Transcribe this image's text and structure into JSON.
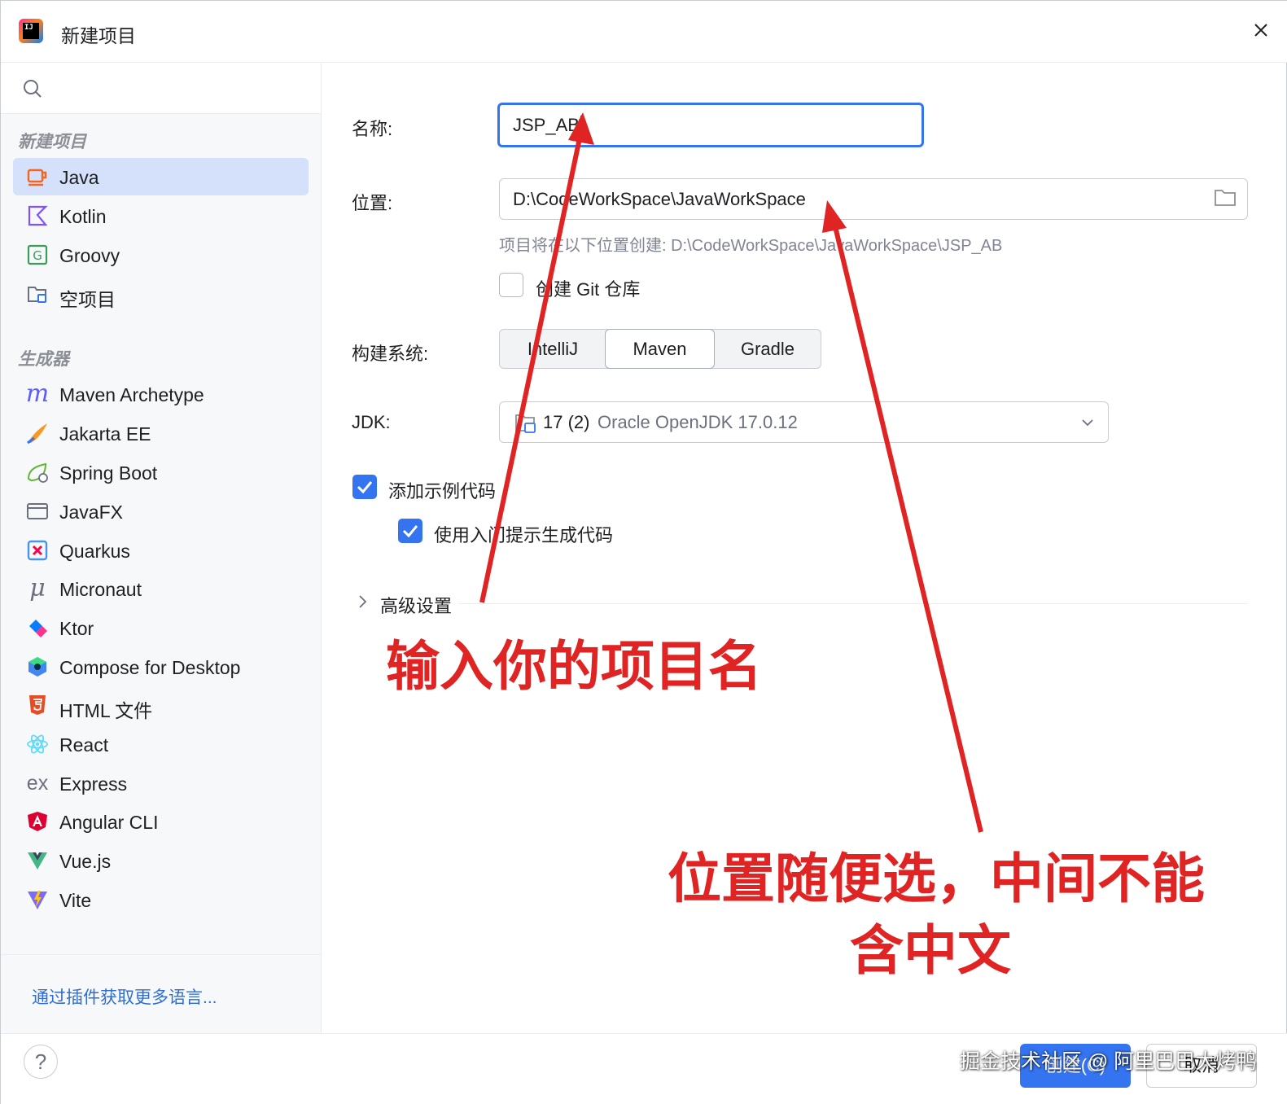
{
  "window": {
    "title": "新建项目",
    "close_icon": "close-icon",
    "app_icon": "intellij-idea-icon",
    "app_icon_text": "IJ"
  },
  "sidebar": {
    "search_icon": "search-icon",
    "new_project_header": "新建项目",
    "project_items": [
      {
        "label": "Java",
        "icon": "java-icon",
        "selected": true
      },
      {
        "label": "Kotlin",
        "icon": "kotlin-icon"
      },
      {
        "label": "Groovy",
        "icon": "groovy-icon"
      },
      {
        "label": "空项目",
        "icon": "empty-project-icon"
      }
    ],
    "generators_header": "生成器",
    "generator_items": [
      {
        "label": "Maven Archetype",
        "icon": "maven-icon"
      },
      {
        "label": "Jakarta EE",
        "icon": "jakarta-ee-icon"
      },
      {
        "label": "Spring Boot",
        "icon": "spring-boot-icon"
      },
      {
        "label": "JavaFX",
        "icon": "javafx-icon"
      },
      {
        "label": "Quarkus",
        "icon": "quarkus-icon"
      },
      {
        "label": "Micronaut",
        "icon": "micronaut-icon"
      },
      {
        "label": "Ktor",
        "icon": "ktor-icon"
      },
      {
        "label": "Compose for Desktop",
        "icon": "compose-icon"
      },
      {
        "label": "HTML 文件",
        "icon": "html5-icon"
      },
      {
        "label": "React",
        "icon": "react-icon"
      },
      {
        "label": "Express",
        "icon": "express-icon"
      },
      {
        "label": "Angular CLI",
        "icon": "angular-icon"
      },
      {
        "label": "Vue.js",
        "icon": "vue-icon"
      },
      {
        "label": "Vite",
        "icon": "vite-icon"
      }
    ],
    "more_languages_link": "通过插件获取更多语言..."
  },
  "form": {
    "name_label": "名称:",
    "name_value": "JSP_AB",
    "location_label": "位置:",
    "location_value": "D:\\CodeWorkSpace\\JavaWorkSpace",
    "location_hint": "项目将在以下位置创建: D:\\CodeWorkSpace\\JavaWorkSpace\\JSP_AB",
    "git_checkbox_label": "创建 Git 仓库",
    "git_checked": false,
    "build_system_label": "构建系统:",
    "build_options": [
      "IntelliJ",
      "Maven",
      "Gradle"
    ],
    "build_selected": "Maven",
    "jdk_label": "JDK:",
    "jdk_version": "17 (2)",
    "jdk_name": "Oracle OpenJDK 17.0.12",
    "sample_code_label": "添加示例代码",
    "sample_code_checked": true,
    "onboarding_label": "使用入门提示生成代码",
    "onboarding_checked": true,
    "advanced_label": "高级设置"
  },
  "annotations": {
    "name_note": "输入你的项目名",
    "location_note_line1": "位置随便选，中间不能",
    "location_note_line2": "含中文",
    "color": "#e02323"
  },
  "footer": {
    "help": "?",
    "create_button": "创建(C)",
    "cancel_button": "取消",
    "watermark": "掘金技术社区 @ 阿里巴巴大烤鸭"
  },
  "colors": {
    "accent": "#3574f0",
    "selection": "#d5e1fa",
    "link": "#2e6dd6"
  }
}
